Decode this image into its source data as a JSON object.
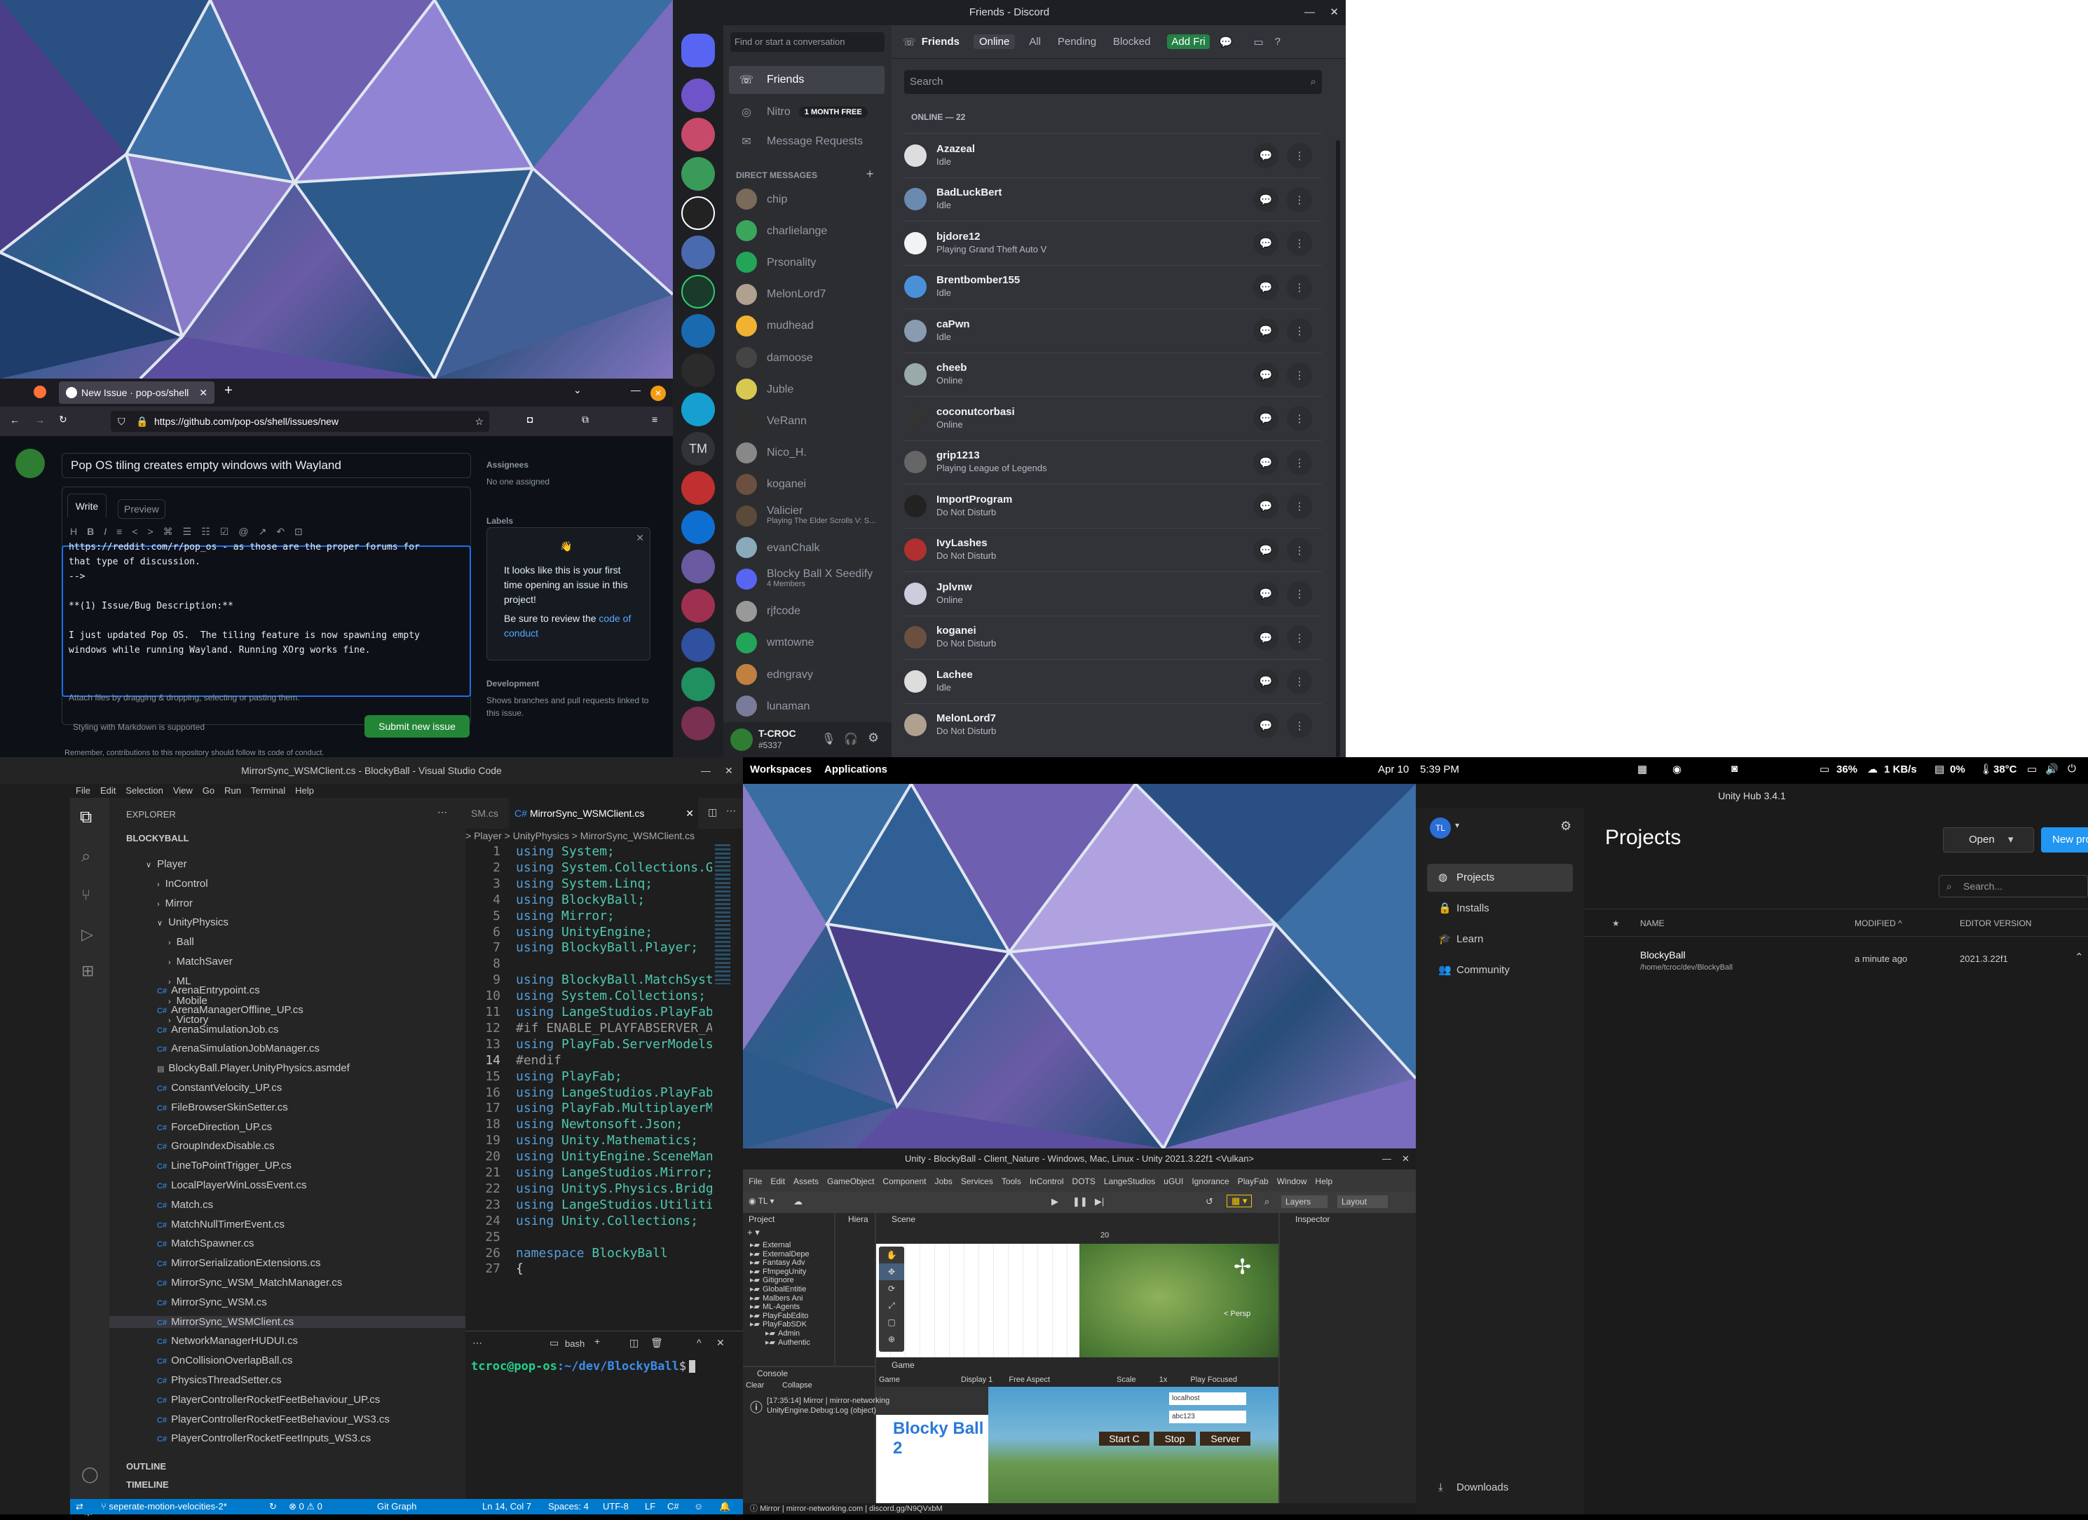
{
  "discord": {
    "title": "Friends - Discord",
    "search_placeholder": "Find or start a conversation",
    "header": {
      "friends": "Friends",
      "online": "Online",
      "all": "All",
      "pending": "Pending",
      "blocked": "Blocked",
      "add": "Add Fri"
    },
    "nav": {
      "friends": "Friends",
      "nitro": "Nitro",
      "nitro_badge": "1 MONTH FREE",
      "requests": "Message Requests"
    },
    "dm_header": "DIRECT MESSAGES",
    "dms": [
      {
        "name": "chip",
        "color": "#7a6a5a"
      },
      {
        "name": "charlielange",
        "color": "#3ba55c"
      },
      {
        "name": "Prsonality",
        "color": "#23a559"
      },
      {
        "name": "MelonLord7",
        "color": "#b0a090"
      },
      {
        "name": "mudhead",
        "color": "#f0b232"
      },
      {
        "name": "damoose",
        "color": "#444"
      },
      {
        "name": "Juble",
        "color": "#d8c850"
      },
      {
        "name": "VeRann",
        "color": "#2d2d2d"
      },
      {
        "name": "Nico_H.",
        "color": "#888"
      },
      {
        "name": "koganei",
        "color": "#6b5040"
      },
      {
        "name": "Valicier",
        "sub": "Playing The Elder Scrolls V: S...",
        "color": "#5a4a3a"
      },
      {
        "name": "evanChalk",
        "color": "#8ab"
      },
      {
        "name": "Blocky Ball X Seedify",
        "sub": "4 Members",
        "color": "#5865f2"
      },
      {
        "name": "rjfcode",
        "color": "#999"
      },
      {
        "name": "wmtowne",
        "color": "#23a559"
      },
      {
        "name": "edngravy",
        "color": "#c08040"
      },
      {
        "name": "lunaman",
        "color": "#7a7a9a"
      }
    ],
    "user": {
      "name": "T-CROC",
      "tag": "#5337"
    },
    "search": "Search",
    "online_header": "ONLINE — 22",
    "friends": [
      {
        "name": "Azazeal",
        "status": "Idle",
        "color": "#ddd"
      },
      {
        "name": "BadLuckBert",
        "status": "Idle",
        "color": "#6a8ab0"
      },
      {
        "name": "bjdore12",
        "status": "Playing Grand Theft Auto V",
        "color": "#f2f3f5"
      },
      {
        "name": "Brentbomber155",
        "status": "Idle",
        "color": "#4a90d9"
      },
      {
        "name": "caPwn",
        "status": "Idle",
        "color": "#8a9ab0"
      },
      {
        "name": "cheeb",
        "status": "Online",
        "color": "#9aa"
      },
      {
        "name": "coconutcorbasi",
        "status": "Online",
        "color": "#333"
      },
      {
        "name": "grip1213",
        "status": "Playing League of Legends",
        "color": "#666"
      },
      {
        "name": "ImportProgram",
        "status": "Do Not Disturb",
        "color": "#222"
      },
      {
        "name": "IvyLashes",
        "status": "Do Not Disturb",
        "color": "#b03030"
      },
      {
        "name": "Jplvnw",
        "status": "Online",
        "color": "#ccd"
      },
      {
        "name": "koganei",
        "status": "Do Not Disturb",
        "color": "#6b5040"
      },
      {
        "name": "Lachee",
        "status": "Idle",
        "color": "#ddd"
      },
      {
        "name": "MelonLord7",
        "status": "Do Not Disturb",
        "color": "#b0a090"
      }
    ]
  },
  "firefox": {
    "tab": "New Issue · pop-os/shell",
    "url": "https://github.com/pop-os/shell/issues/new",
    "title_value": "Pop OS tiling creates empty windows with Wayland",
    "write": "Write",
    "preview": "Preview",
    "body_lines": [
      "https://reddit.com/r/pop_os - as those are the proper forums for",
      "that type of discussion.",
      "-->",
      "",
      "**(1) Issue/Bug Description:**",
      "",
      "I just updated Pop OS.  The tiling feature is now spawning empty",
      "windows while running Wayland. Running XOrg works fine."
    ],
    "attach": "Attach files by dragging & dropping, selecting or pasting them.",
    "markdown": "Styling with Markdown is supported",
    "submit": "Submit new issue",
    "assignees": "Assignees",
    "no_one": "No one assigned",
    "labels": "Labels",
    "popup": "It looks like this is your first time opening an issue in this project!",
    "popup2": "Be sure to review the ",
    "popup_link": "code of conduct",
    "development": "Development",
    "dev_text": "Shows branches and pull requests linked to this issue.",
    "footer": "Remember, contributions to this repository should follow its code of conduct."
  },
  "vscode": {
    "title": "MirrorSync_WSMClient.cs - BlockyBall - Visual Studio Code",
    "menu": [
      "File",
      "Edit",
      "Selection",
      "View",
      "Go",
      "Run",
      "Terminal",
      "Help"
    ],
    "explorer": "EXPLORER",
    "project": "BLOCKYBALL",
    "folders": [
      "Player",
      "InControl",
      "Mirror",
      "UnityPhysics",
      "Ball",
      "MatchSaver",
      "ML",
      "Mobile",
      "Victory"
    ],
    "files": [
      "ArenaEntrypoint.cs",
      "ArenaManagerOffline_UP.cs",
      "ArenaSimulationJob.cs",
      "ArenaSimulationJobManager.cs",
      "BlockyBall.Player.UnityPhysics.asmdef",
      "ConstantVelocity_UP.cs",
      "FileBrowserSkinSetter.cs",
      "ForceDirection_UP.cs",
      "GroupIndexDisable.cs",
      "LineToPointTrigger_UP.cs",
      "LocalPlayerWinLossEvent.cs",
      "Match.cs",
      "MatchNullTimerEvent.cs",
      "MatchSpawner.cs",
      "MirrorSerializationExtensions.cs",
      "MirrorSync_WSM_MatchManager.cs",
      "MirrorSync_WSM.cs",
      "MirrorSync_WSMClient.cs",
      "NetworkManagerHUDUI.cs",
      "OnCollisionOverlapBall.cs",
      "PhysicsThreadSetter.cs",
      "PlayerControllerRocketFeetBehaviour_UP.cs",
      "PlayerControllerRocketFeetBehaviour_WS3.cs",
      "PlayerControllerRocketFeetInputs_WS3.cs"
    ],
    "outline": "OUTLINE",
    "timeline": "TIMELINE",
    "tab_prev": "SM.cs",
    "tab": "MirrorSync_WSMClient.cs",
    "breadcrumb": "> Player > UnityPhysics > MirrorSync_WSMClient.cs",
    "code": [
      [
        "1",
        "using System;"
      ],
      [
        "2",
        "using System.Collections.G"
      ],
      [
        "3",
        "using System.Linq;"
      ],
      [
        "4",
        "using BlockyBall;"
      ],
      [
        "5",
        "using Mirror;"
      ],
      [
        "6",
        "using UnityEngine;"
      ],
      [
        "7",
        "using BlockyBall.Player;"
      ],
      [
        "8",
        ""
      ],
      [
        "9",
        "using BlockyBall.MatchSyst"
      ],
      [
        "10",
        "using System.Collections;"
      ],
      [
        "11",
        "using LangeStudios.PlayFab"
      ],
      [
        "12",
        "#if ENABLE_PLAYFABSERVER_A"
      ],
      [
        "13",
        "using PlayFab.ServerModels"
      ],
      [
        "14",
        "#endif"
      ],
      [
        "15",
        "using PlayFab;"
      ],
      [
        "16",
        "using LangeStudios.PlayFab"
      ],
      [
        "17",
        "using PlayFab.MultiplayerM"
      ],
      [
        "18",
        "using Newtonsoft.Json;"
      ],
      [
        "19",
        "using Unity.Mathematics;"
      ],
      [
        "20",
        "using UnityEngine.SceneMan"
      ],
      [
        "21",
        "using LangeStudios.Mirror;"
      ],
      [
        "22",
        "using UnityS.Physics.Bridg"
      ],
      [
        "23",
        "using LangeStudios.Utiliti"
      ],
      [
        "24",
        "using Unity.Collections;"
      ],
      [
        "25",
        ""
      ],
      [
        "26",
        "namespace BlockyBall"
      ],
      [
        "27",
        "{"
      ]
    ],
    "terminal_shell": "bash",
    "prompt_user": "tcroc@pop-os",
    "prompt_path": ":~/dev/BlockyBall",
    "prompt_sym": "$",
    "status": {
      "branch": "seperate-motion-velocities-2*",
      "errors": "0",
      "warnings": "0",
      "git": "Git Graph",
      "pos": "Ln 14, Col 7",
      "spaces": "Spaces: 4",
      "enc": "UTF-8",
      "eol": "LF",
      "lang": "C#"
    }
  },
  "topbar": {
    "workspaces": "Workspaces",
    "applications": "Applications",
    "date": "Apr 10",
    "time": "5:39 PM",
    "cpu": "36%",
    "net": "1 KB/s",
    "mem": "0%",
    "temp": "38°C"
  },
  "unity": {
    "title": "Unity - BlockyBall - Client_Nature - Windows, Mac, Linux - Unity 2021.3.22f1 <Vulkan>",
    "menu": [
      "File",
      "Edit",
      "Assets",
      "GameObject",
      "Component",
      "Jobs",
      "Services",
      "Tools",
      "InControl",
      "DOTS",
      "LangeStudios",
      "uGUI",
      "Ignorance",
      "PlayFab",
      "Window",
      "Help"
    ],
    "project": "Project",
    "hierarchy": "Hiera",
    "scene": "Scene",
    "inspector": "Inspector",
    "game": "Game",
    "console": "Console",
    "assets": [
      "External",
      "ExternalDepe",
      "Fantasy Adv",
      "FfmpegUnity",
      "Gitignore",
      "GlobalEntitie",
      "Malbers Ani",
      "ML-Agents",
      "PlayFabEdito",
      "PlayFabSDK",
      "Admin",
      "Authentic"
    ],
    "layers": "Layers",
    "layout": "Layout",
    "game_bar": {
      "display": "Display 1",
      "aspect": "Free Aspect",
      "scale": "Scale",
      "scale_val": "1x",
      "play": "Play Focused",
      "game": "Game"
    },
    "clear": "Clear",
    "collapse": "Collapse",
    "log1": "[17:35:14] Mirror | mirror-networking",
    "log2": "UnityEngine.Debug:Log (object)",
    "status_msg": "Mirror | mirror-networking.com | discord.gg/N9QVxbM",
    "game_ui": {
      "host": "localhost",
      "pass": "abc123",
      "startc": "Start C",
      "stop": "Stop",
      "server": "Server",
      "logo": "Blocky Ball 2"
    },
    "persp": "< Persp",
    "zoom": "20"
  },
  "hub": {
    "title": "Unity Hub 3.4.1",
    "avatar": "TL",
    "nav": [
      "Projects",
      "Installs",
      "Learn",
      "Community"
    ],
    "downloads": "Downloads",
    "heading": "Projects",
    "open": "Open",
    "new": "New proje",
    "search": "Search...",
    "cols": {
      "name": "NAME",
      "modified": "MODIFIED",
      "version": "EDITOR VERSION"
    },
    "project": {
      "name": "BlockyBall",
      "path": "/home/tcroc/dev/BlockyBall",
      "modified": "a minute ago",
      "version": "2021.3.22f1"
    }
  }
}
